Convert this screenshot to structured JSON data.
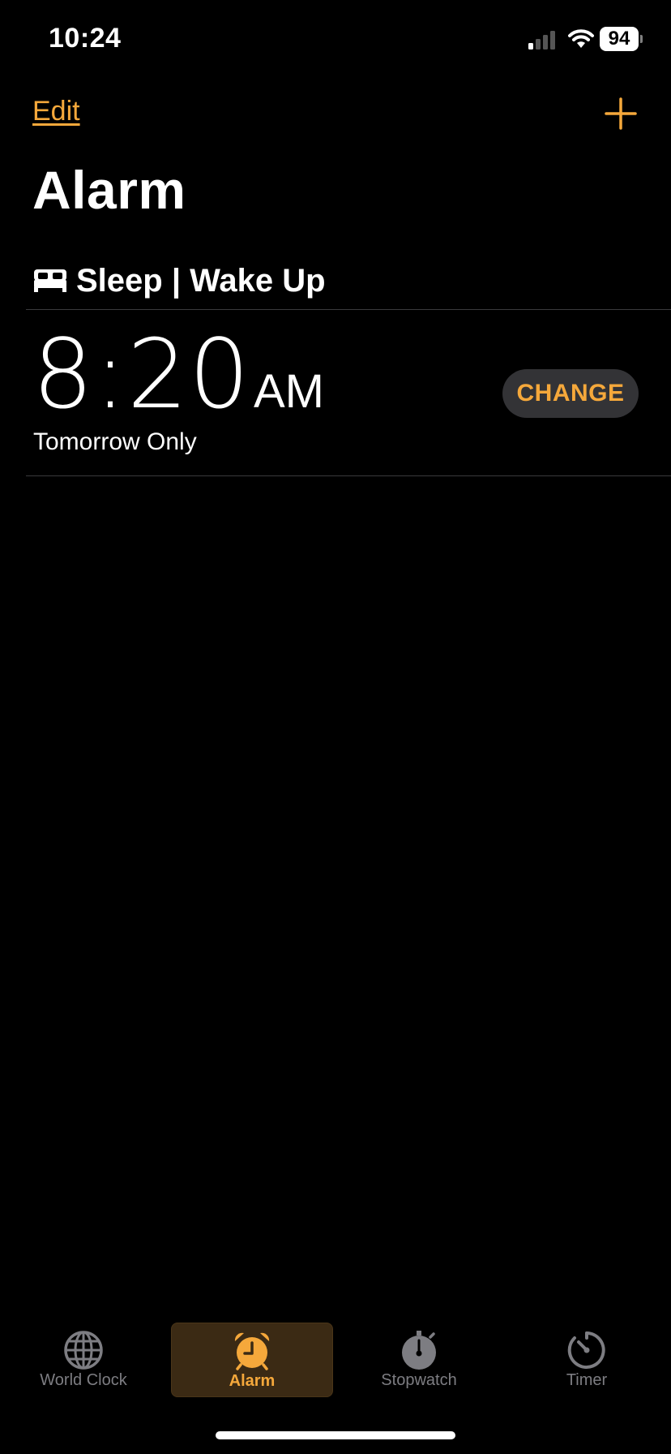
{
  "status_bar": {
    "time": "10:24",
    "battery": "94"
  },
  "nav": {
    "edit_label": "Edit",
    "add_icon": "plus-icon"
  },
  "page": {
    "title": "Alarm"
  },
  "section": {
    "icon": "bed-icon",
    "title": "Sleep | Wake Up"
  },
  "alarm": {
    "time": "8:20",
    "period": "AM",
    "repeat": "Tomorrow Only",
    "change_label": "CHANGE"
  },
  "tabs": [
    {
      "label": "World Clock",
      "icon": "globe-icon",
      "active": false
    },
    {
      "label": "Alarm",
      "icon": "alarm-clock-icon",
      "active": true
    },
    {
      "label": "Stopwatch",
      "icon": "stopwatch-icon",
      "active": false
    },
    {
      "label": "Timer",
      "icon": "timer-icon",
      "active": false
    }
  ],
  "colors": {
    "accent": "#F5A83B",
    "background": "#000000",
    "inactive_tab": "#7d7d82"
  }
}
